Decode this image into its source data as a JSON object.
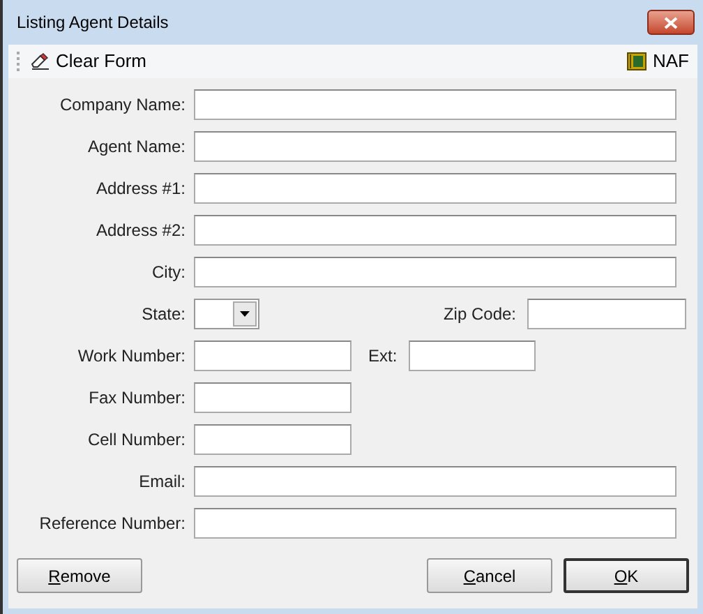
{
  "window": {
    "title": "Listing Agent Details"
  },
  "toolbar": {
    "clear": "Clear Form",
    "naf": "NAF"
  },
  "rows": [
    {
      "fields": [
        {
          "label": "Company Name:",
          "kind": "wide"
        }
      ]
    },
    {
      "fields": [
        {
          "label": "Agent Name:",
          "kind": "wide"
        }
      ]
    },
    {
      "fields": [
        {
          "label": "Address #1:",
          "kind": "wide"
        }
      ]
    },
    {
      "fields": [
        {
          "label": "Address #2:",
          "kind": "wide"
        }
      ]
    },
    {
      "fields": [
        {
          "label": "City:",
          "kind": "wide"
        }
      ]
    },
    {
      "fields": [
        {
          "label": "State:",
          "kind": "combo"
        },
        {
          "label": "Zip Code:",
          "kind": "zip"
        }
      ]
    },
    {
      "fields": [
        {
          "label": "Work Number:",
          "kind": "medium"
        },
        {
          "label": "Ext:",
          "kind": "ext"
        }
      ]
    },
    {
      "fields": [
        {
          "label": "Fax Number:",
          "kind": "medium"
        }
      ]
    },
    {
      "fields": [
        {
          "label": "Cell Number:",
          "kind": "medium"
        }
      ]
    },
    {
      "fields": [
        {
          "label": "Email:",
          "kind": "wide"
        }
      ]
    },
    {
      "fields": [
        {
          "label": "Reference Number:",
          "kind": "wide"
        }
      ]
    }
  ],
  "buttons": [
    {
      "label": "Remove",
      "underline_first": true,
      "default": false
    },
    {
      "label": "Cancel",
      "underline_first": true,
      "default": false
    },
    {
      "label": "OK",
      "underline_first": true,
      "default": true
    }
  ]
}
